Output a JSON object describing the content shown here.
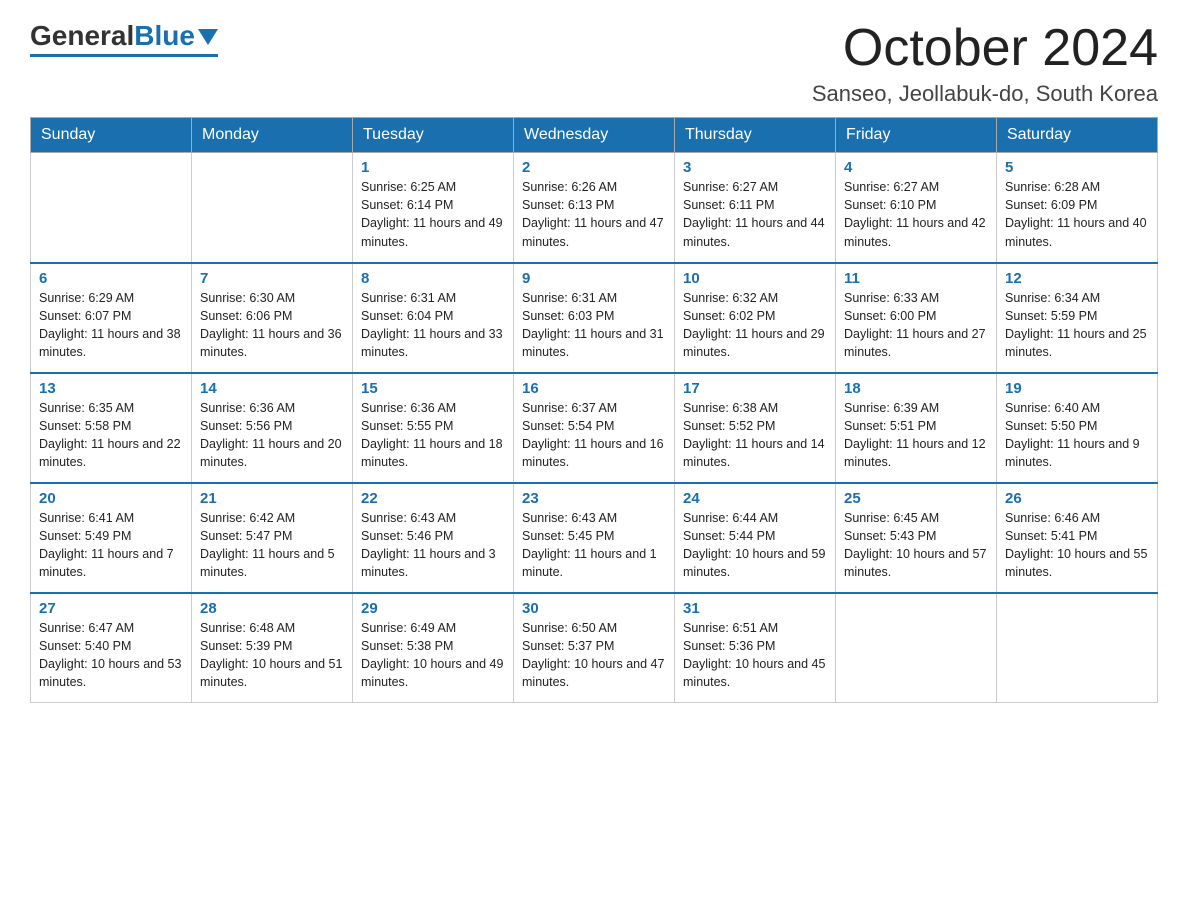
{
  "header": {
    "logo_general": "General",
    "logo_blue": "Blue",
    "month_title": "October 2024",
    "location": "Sanseo, Jeollabuk-do, South Korea"
  },
  "weekdays": [
    "Sunday",
    "Monday",
    "Tuesday",
    "Wednesday",
    "Thursday",
    "Friday",
    "Saturday"
  ],
  "weeks": [
    [
      {
        "day": "",
        "sunrise": "",
        "sunset": "",
        "daylight": ""
      },
      {
        "day": "",
        "sunrise": "",
        "sunset": "",
        "daylight": ""
      },
      {
        "day": "1",
        "sunrise": "Sunrise: 6:25 AM",
        "sunset": "Sunset: 6:14 PM",
        "daylight": "Daylight: 11 hours and 49 minutes."
      },
      {
        "day": "2",
        "sunrise": "Sunrise: 6:26 AM",
        "sunset": "Sunset: 6:13 PM",
        "daylight": "Daylight: 11 hours and 47 minutes."
      },
      {
        "day": "3",
        "sunrise": "Sunrise: 6:27 AM",
        "sunset": "Sunset: 6:11 PM",
        "daylight": "Daylight: 11 hours and 44 minutes."
      },
      {
        "day": "4",
        "sunrise": "Sunrise: 6:27 AM",
        "sunset": "Sunset: 6:10 PM",
        "daylight": "Daylight: 11 hours and 42 minutes."
      },
      {
        "day": "5",
        "sunrise": "Sunrise: 6:28 AM",
        "sunset": "Sunset: 6:09 PM",
        "daylight": "Daylight: 11 hours and 40 minutes."
      }
    ],
    [
      {
        "day": "6",
        "sunrise": "Sunrise: 6:29 AM",
        "sunset": "Sunset: 6:07 PM",
        "daylight": "Daylight: 11 hours and 38 minutes."
      },
      {
        "day": "7",
        "sunrise": "Sunrise: 6:30 AM",
        "sunset": "Sunset: 6:06 PM",
        "daylight": "Daylight: 11 hours and 36 minutes."
      },
      {
        "day": "8",
        "sunrise": "Sunrise: 6:31 AM",
        "sunset": "Sunset: 6:04 PM",
        "daylight": "Daylight: 11 hours and 33 minutes."
      },
      {
        "day": "9",
        "sunrise": "Sunrise: 6:31 AM",
        "sunset": "Sunset: 6:03 PM",
        "daylight": "Daylight: 11 hours and 31 minutes."
      },
      {
        "day": "10",
        "sunrise": "Sunrise: 6:32 AM",
        "sunset": "Sunset: 6:02 PM",
        "daylight": "Daylight: 11 hours and 29 minutes."
      },
      {
        "day": "11",
        "sunrise": "Sunrise: 6:33 AM",
        "sunset": "Sunset: 6:00 PM",
        "daylight": "Daylight: 11 hours and 27 minutes."
      },
      {
        "day": "12",
        "sunrise": "Sunrise: 6:34 AM",
        "sunset": "Sunset: 5:59 PM",
        "daylight": "Daylight: 11 hours and 25 minutes."
      }
    ],
    [
      {
        "day": "13",
        "sunrise": "Sunrise: 6:35 AM",
        "sunset": "Sunset: 5:58 PM",
        "daylight": "Daylight: 11 hours and 22 minutes."
      },
      {
        "day": "14",
        "sunrise": "Sunrise: 6:36 AM",
        "sunset": "Sunset: 5:56 PM",
        "daylight": "Daylight: 11 hours and 20 minutes."
      },
      {
        "day": "15",
        "sunrise": "Sunrise: 6:36 AM",
        "sunset": "Sunset: 5:55 PM",
        "daylight": "Daylight: 11 hours and 18 minutes."
      },
      {
        "day": "16",
        "sunrise": "Sunrise: 6:37 AM",
        "sunset": "Sunset: 5:54 PM",
        "daylight": "Daylight: 11 hours and 16 minutes."
      },
      {
        "day": "17",
        "sunrise": "Sunrise: 6:38 AM",
        "sunset": "Sunset: 5:52 PM",
        "daylight": "Daylight: 11 hours and 14 minutes."
      },
      {
        "day": "18",
        "sunrise": "Sunrise: 6:39 AM",
        "sunset": "Sunset: 5:51 PM",
        "daylight": "Daylight: 11 hours and 12 minutes."
      },
      {
        "day": "19",
        "sunrise": "Sunrise: 6:40 AM",
        "sunset": "Sunset: 5:50 PM",
        "daylight": "Daylight: 11 hours and 9 minutes."
      }
    ],
    [
      {
        "day": "20",
        "sunrise": "Sunrise: 6:41 AM",
        "sunset": "Sunset: 5:49 PM",
        "daylight": "Daylight: 11 hours and 7 minutes."
      },
      {
        "day": "21",
        "sunrise": "Sunrise: 6:42 AM",
        "sunset": "Sunset: 5:47 PM",
        "daylight": "Daylight: 11 hours and 5 minutes."
      },
      {
        "day": "22",
        "sunrise": "Sunrise: 6:43 AM",
        "sunset": "Sunset: 5:46 PM",
        "daylight": "Daylight: 11 hours and 3 minutes."
      },
      {
        "day": "23",
        "sunrise": "Sunrise: 6:43 AM",
        "sunset": "Sunset: 5:45 PM",
        "daylight": "Daylight: 11 hours and 1 minute."
      },
      {
        "day": "24",
        "sunrise": "Sunrise: 6:44 AM",
        "sunset": "Sunset: 5:44 PM",
        "daylight": "Daylight: 10 hours and 59 minutes."
      },
      {
        "day": "25",
        "sunrise": "Sunrise: 6:45 AM",
        "sunset": "Sunset: 5:43 PM",
        "daylight": "Daylight: 10 hours and 57 minutes."
      },
      {
        "day": "26",
        "sunrise": "Sunrise: 6:46 AM",
        "sunset": "Sunset: 5:41 PM",
        "daylight": "Daylight: 10 hours and 55 minutes."
      }
    ],
    [
      {
        "day": "27",
        "sunrise": "Sunrise: 6:47 AM",
        "sunset": "Sunset: 5:40 PM",
        "daylight": "Daylight: 10 hours and 53 minutes."
      },
      {
        "day": "28",
        "sunrise": "Sunrise: 6:48 AM",
        "sunset": "Sunset: 5:39 PM",
        "daylight": "Daylight: 10 hours and 51 minutes."
      },
      {
        "day": "29",
        "sunrise": "Sunrise: 6:49 AM",
        "sunset": "Sunset: 5:38 PM",
        "daylight": "Daylight: 10 hours and 49 minutes."
      },
      {
        "day": "30",
        "sunrise": "Sunrise: 6:50 AM",
        "sunset": "Sunset: 5:37 PM",
        "daylight": "Daylight: 10 hours and 47 minutes."
      },
      {
        "day": "31",
        "sunrise": "Sunrise: 6:51 AM",
        "sunset": "Sunset: 5:36 PM",
        "daylight": "Daylight: 10 hours and 45 minutes."
      },
      {
        "day": "",
        "sunrise": "",
        "sunset": "",
        "daylight": ""
      },
      {
        "day": "",
        "sunrise": "",
        "sunset": "",
        "daylight": ""
      }
    ]
  ]
}
